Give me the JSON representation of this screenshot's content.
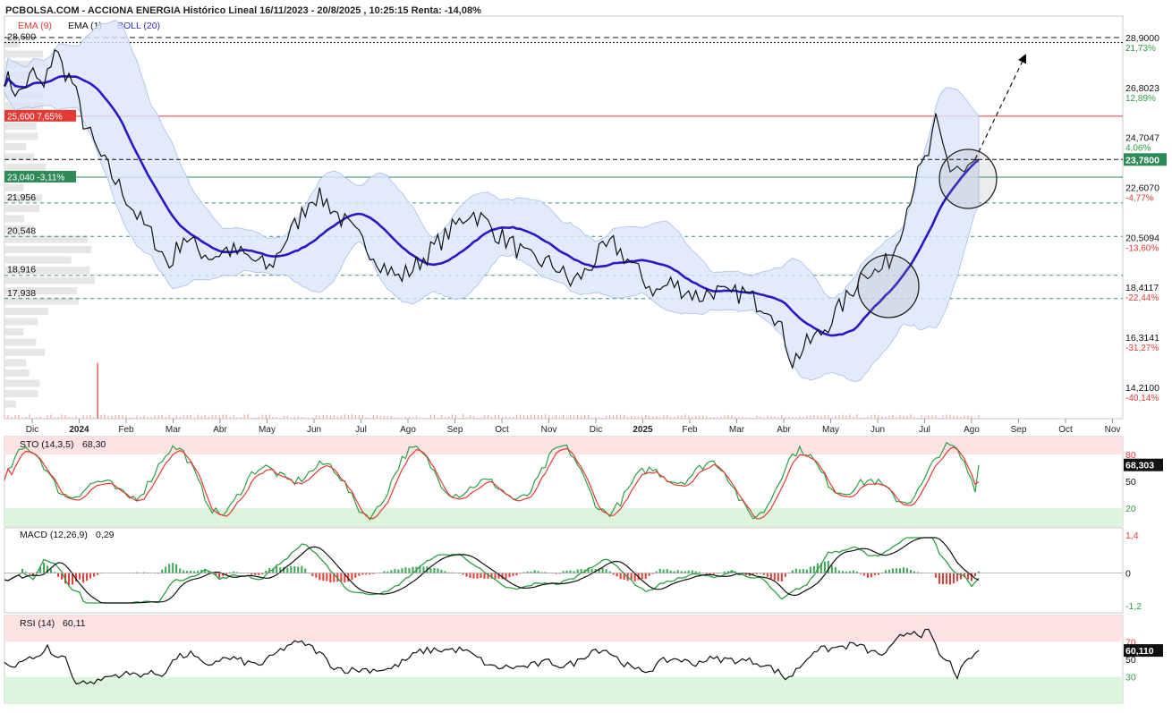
{
  "header": {
    "title": "PCBOLSA.COM - ACCIONA ENERGIA Histórico Lineal 16/11/2023 - 20/8/2025 , 10:25:15 Renta: -14,08%",
    "legend": [
      {
        "label": "EMA (9)",
        "color": "#e53935"
      },
      {
        "label": "EMA (1)",
        "color": "#111111"
      },
      {
        "label": "BOLL (20)",
        "color": "#2b2bc8"
      }
    ]
  },
  "colors": {
    "price": "#111111",
    "boll_mid": "#2a18c4",
    "boll_band": "#dbe6fb",
    "boll_band_edge": "#a9bde8",
    "resistance": "#e53935",
    "support_green": "#2e8b57",
    "dashed_green": "#2e8b7a",
    "positive": "#2e9e44",
    "negative": "#e53935",
    "overbought_zone": "#fde3e3",
    "oversold_zone": "#dcf5dc"
  },
  "chart_data": [
    {
      "type": "line",
      "name": "main",
      "x_labels": [
        "Dic",
        "2024",
        "Feb",
        "Mar",
        "Abr",
        "May",
        "Jun",
        "Jul",
        "Ago",
        "Sep",
        "Oct",
        "Nov",
        "Dic",
        "2025",
        "Feb",
        "Mar",
        "Abr",
        "May",
        "Jun",
        "Jul",
        "Ago",
        "Sep",
        "Oct",
        "Nov"
      ],
      "y_ticks": [
        {
          "value": 28.9,
          "label": "28,9000",
          "pct": "21,73%",
          "pct_color": "#2e9e44"
        },
        {
          "value": 26.8023,
          "label": "26,8023",
          "pct": "12,89%",
          "pct_color": "#2e9e44"
        },
        {
          "value": 24.7047,
          "label": "24,7047",
          "pct": "4,06%",
          "pct_color": "#2e9e44"
        },
        {
          "value": 22.607,
          "label": "22,6070",
          "pct": "-4,77%",
          "pct_color": "#e53935"
        },
        {
          "value": 20.5094,
          "label": "20,5094",
          "pct": "-13,60%",
          "pct_color": "#e53935"
        },
        {
          "value": 18.4117,
          "label": "18,4117",
          "pct": "-22,44%",
          "pct_color": "#e53935"
        },
        {
          "value": 16.3141,
          "label": "16,3141",
          "pct": "-31,27%",
          "pct_color": "#e53935"
        },
        {
          "value": 14.21,
          "label": "14,2100",
          "pct": "-40,14%",
          "pct_color": "#e53935"
        }
      ],
      "ylim": [
        14.21,
        28.9
      ],
      "last_price": {
        "value": 23.78,
        "label": "23,7800"
      },
      "levels": [
        {
          "value": 28.69,
          "label": "28,690",
          "style": "dotted"
        },
        {
          "value": 28.9,
          "label": "",
          "style": "dashed"
        },
        {
          "value": 25.6,
          "label": "25,600  7,65%",
          "style": "resistance"
        },
        {
          "value": 23.04,
          "label": "23,040  -3,11%",
          "style": "support"
        },
        {
          "value": 21.956,
          "label": "21,956",
          "style": "dashed-green"
        },
        {
          "value": 20.548,
          "label": "20,548",
          "style": "dashed-green"
        },
        {
          "value": 18.916,
          "label": "18,916",
          "style": "dashed-green"
        },
        {
          "value": 17.938,
          "label": "17,938",
          "style": "dashed-green"
        }
      ],
      "price_keypoints": [
        [
          0,
          27.3
        ],
        [
          4,
          26.5
        ],
        [
          8,
          27.4
        ],
        [
          11,
          26.7
        ],
        [
          14,
          28.5
        ],
        [
          16,
          27.7
        ],
        [
          19,
          27.0
        ],
        [
          22,
          25.4
        ],
        [
          26,
          24.1
        ],
        [
          30,
          23.1
        ],
        [
          34,
          22.2
        ],
        [
          38,
          21.2
        ],
        [
          42,
          20.4
        ],
        [
          46,
          19.3
        ],
        [
          50,
          20.6
        ],
        [
          54,
          20.0
        ],
        [
          58,
          19.7
        ],
        [
          62,
          20.0
        ],
        [
          66,
          19.8
        ],
        [
          70,
          19.5
        ],
        [
          74,
          19.2
        ],
        [
          78,
          20.3
        ],
        [
          82,
          21.2
        ],
        [
          86,
          22.3
        ],
        [
          90,
          22.0
        ],
        [
          94,
          21.3
        ],
        [
          98,
          20.6
        ],
        [
          102,
          20.0
        ],
        [
          106,
          19.3
        ],
        [
          110,
          18.8
        ],
        [
          114,
          19.2
        ],
        [
          118,
          19.8
        ],
        [
          122,
          20.4
        ],
        [
          126,
          21.0
        ],
        [
          130,
          21.6
        ],
        [
          134,
          21.2
        ],
        [
          138,
          20.6
        ],
        [
          142,
          20.2
        ],
        [
          146,
          19.6
        ],
        [
          150,
          19.5
        ],
        [
          154,
          19.3
        ],
        [
          158,
          18.6
        ],
        [
          162,
          19.0
        ],
        [
          166,
          19.8
        ],
        [
          170,
          20.2
        ],
        [
          174,
          19.6
        ],
        [
          178,
          18.8
        ],
        [
          182,
          18.2
        ],
        [
          186,
          18.6
        ],
        [
          190,
          18.3
        ],
        [
          194,
          18.0
        ],
        [
          198,
          18.3
        ],
        [
          202,
          18.0
        ],
        [
          206,
          18.2
        ],
        [
          210,
          17.8
        ],
        [
          214,
          17.6
        ],
        [
          218,
          16.2
        ],
        [
          220,
          15.3
        ],
        [
          224,
          16.0
        ],
        [
          228,
          16.5
        ],
        [
          232,
          17.3
        ],
        [
          236,
          18.1
        ],
        [
          240,
          19.2
        ],
        [
          244,
          19.0
        ],
        [
          248,
          19.8
        ],
        [
          250,
          20.8
        ],
        [
          254,
          22.8
        ],
        [
          258,
          24.0
        ],
        [
          260,
          25.3
        ],
        [
          262,
          24.3
        ],
        [
          264,
          23.4
        ],
        [
          266,
          23.5
        ],
        [
          268,
          23.2
        ],
        [
          270,
          23.5
        ],
        [
          272,
          23.8
        ]
      ],
      "n_points": 273
    },
    {
      "type": "line",
      "name": "STO (14,3,5)",
      "label": "STO (14,3,5)",
      "value_label": "68,30",
      "last": {
        "value": 68.303,
        "label": "68,303"
      },
      "ylim": [
        0,
        100
      ],
      "levels": [
        {
          "value": 80,
          "label": "80"
        },
        {
          "value": 50,
          "label": "50"
        },
        {
          "value": 20,
          "label": "20"
        }
      ]
    },
    {
      "type": "line",
      "name": "MACD (12,26,9)",
      "label": "MACD (12,26,9)",
      "value_label": "0,29",
      "ylim": [
        -1.2,
        1.4
      ],
      "levels": [
        {
          "value": 1.4,
          "label": "1,4"
        },
        {
          "value": 0,
          "label": "0"
        },
        {
          "value": -1.2,
          "label": "-1,2"
        }
      ]
    },
    {
      "type": "line",
      "name": "RSI (14)",
      "label": "RSI (14)",
      "value_label": "60,11",
      "last": {
        "value": 60.11,
        "label": "60,110"
      },
      "ylim": [
        0,
        100
      ],
      "levels": [
        {
          "value": 70,
          "label": "70"
        },
        {
          "value": 50,
          "label": "50"
        },
        {
          "value": 30,
          "label": "30"
        }
      ]
    }
  ]
}
